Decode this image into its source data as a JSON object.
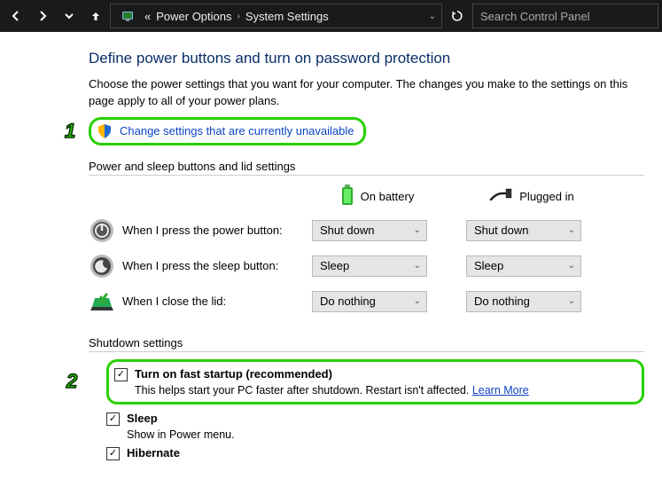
{
  "titlebar": {
    "path_prefix": "«",
    "path1": "Power Options",
    "path2": "System Settings",
    "search_placeholder": "Search Control Panel"
  },
  "page": {
    "title": "Define power buttons and turn on password protection",
    "desc": "Choose the power settings that you want for your computer. The changes you make to the settings on this page apply to all of your power plans.",
    "change_link": "Change settings that are currently unavailable"
  },
  "callouts": {
    "one": "1",
    "two": "2"
  },
  "sections": {
    "buttons_lid": "Power and sleep buttons and lid settings",
    "shutdown": "Shutdown settings"
  },
  "columns": {
    "battery": "On battery",
    "plugged": "Plugged in"
  },
  "rows": {
    "power_btn": {
      "label": "When I press the power button:",
      "battery": "Shut down",
      "plugged": "Shut down"
    },
    "sleep_btn": {
      "label": "When I press the sleep button:",
      "battery": "Sleep",
      "plugged": "Sleep"
    },
    "lid": {
      "label": "When I close the lid:",
      "battery": "Do nothing",
      "plugged": "Do nothing"
    }
  },
  "shutdown": {
    "fast_startup": {
      "label": "Turn on fast startup (recommended)",
      "desc_prefix": "This helps start your PC faster after shutdown. Restart isn't affected. ",
      "learn": "Learn More"
    },
    "sleep": {
      "label": "Sleep",
      "desc": "Show in Power menu."
    },
    "hibernate": {
      "label": "Hibernate"
    }
  }
}
